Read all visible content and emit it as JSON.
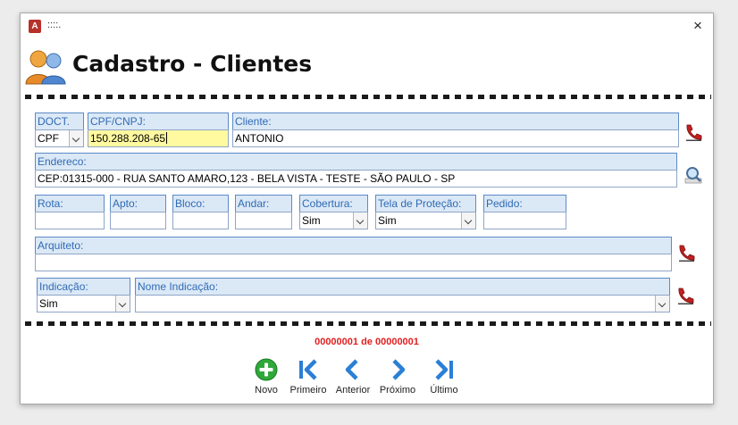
{
  "window": {
    "app_icon_letter": "A",
    "title_text": "::::.",
    "close_symbol": "×"
  },
  "header": {
    "title": "Cadastro - Clientes",
    "icon": "users-icon"
  },
  "form": {
    "doct": {
      "label": "DOCT.",
      "value": "CPF"
    },
    "cpf_cnpj": {
      "label": "CPF/CNPJ:",
      "value": "150.288.208-65"
    },
    "cliente": {
      "label": "Cliente:",
      "value": "ANTONIO"
    },
    "endereco": {
      "label": "Endereco:",
      "value": "CEP:01315-000 - RUA SANTO AMARO,123 - BELA VISTA - TESTE - SÃO PAULO - SP"
    },
    "rota": {
      "label": "Rota:",
      "value": ""
    },
    "apto": {
      "label": "Apto:",
      "value": ""
    },
    "bloco": {
      "label": "Bloco:",
      "value": ""
    },
    "andar": {
      "label": "Andar:",
      "value": ""
    },
    "cobertura": {
      "label": "Cobertura:",
      "value": "Sim"
    },
    "tela_protecao": {
      "label": "Tela de Proteção:",
      "value": "Sim"
    },
    "pedido": {
      "label": "Pedido:",
      "value": ""
    },
    "arquiteto": {
      "label": "Arquiteto:",
      "value": ""
    },
    "indicacao": {
      "label": "Indicação:",
      "value": "Sim"
    },
    "nome_indicacao": {
      "label": "Nome Indicação:",
      "value": ""
    }
  },
  "side_icons": {
    "phone": "phone-icon",
    "search": "magnifier-icon"
  },
  "navigation": {
    "record_counter": "00000001 de 00000001",
    "buttons": [
      {
        "label": "Novo",
        "icon": "plus-circle-icon"
      },
      {
        "label": "Primeiro",
        "icon": "first-record-icon"
      },
      {
        "label": "Anterior",
        "icon": "previous-record-icon"
      },
      {
        "label": "Próximo",
        "icon": "next-record-icon"
      },
      {
        "label": "Último",
        "icon": "last-record-icon"
      }
    ]
  },
  "colors": {
    "label_bg": "#dbe8f6",
    "label_text": "#2f6bb5",
    "focused_field": "#fff9a0",
    "counter": "#e02020",
    "nav_blue": "#2a7fd6",
    "nav_green": "#2fa83a"
  }
}
